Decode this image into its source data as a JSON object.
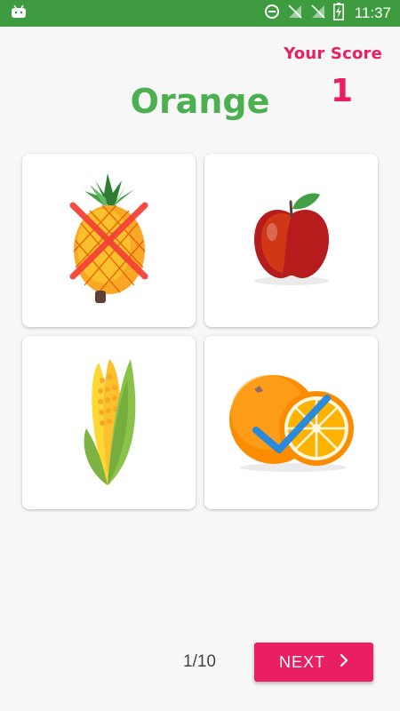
{
  "status_bar": {
    "time": "11:37",
    "icons": [
      "android-icon",
      "data-saver-icon",
      "no-signal-icon",
      "no-sim-icon",
      "battery-charging-icon"
    ],
    "background_color": "#3e9b40"
  },
  "score": {
    "label": "Your Score",
    "value": "1",
    "color": "#e91e63"
  },
  "question": {
    "word": "Orange",
    "color": "#4caf50"
  },
  "options": [
    {
      "item": "pineapple",
      "icon": "pineapple-icon",
      "mark": "wrong",
      "mark_icon": "red-cross-icon"
    },
    {
      "item": "apple",
      "icon": "apple-icon",
      "mark": "none"
    },
    {
      "item": "corn",
      "icon": "corn-icon",
      "mark": "none"
    },
    {
      "item": "orange",
      "icon": "orange-icon",
      "mark": "correct",
      "mark_icon": "blue-checkmark-icon"
    }
  ],
  "footer": {
    "progress": "1/10",
    "next_label": "NEXT",
    "next_icon": "chevron-right-icon",
    "button_color": "#e91e63"
  }
}
